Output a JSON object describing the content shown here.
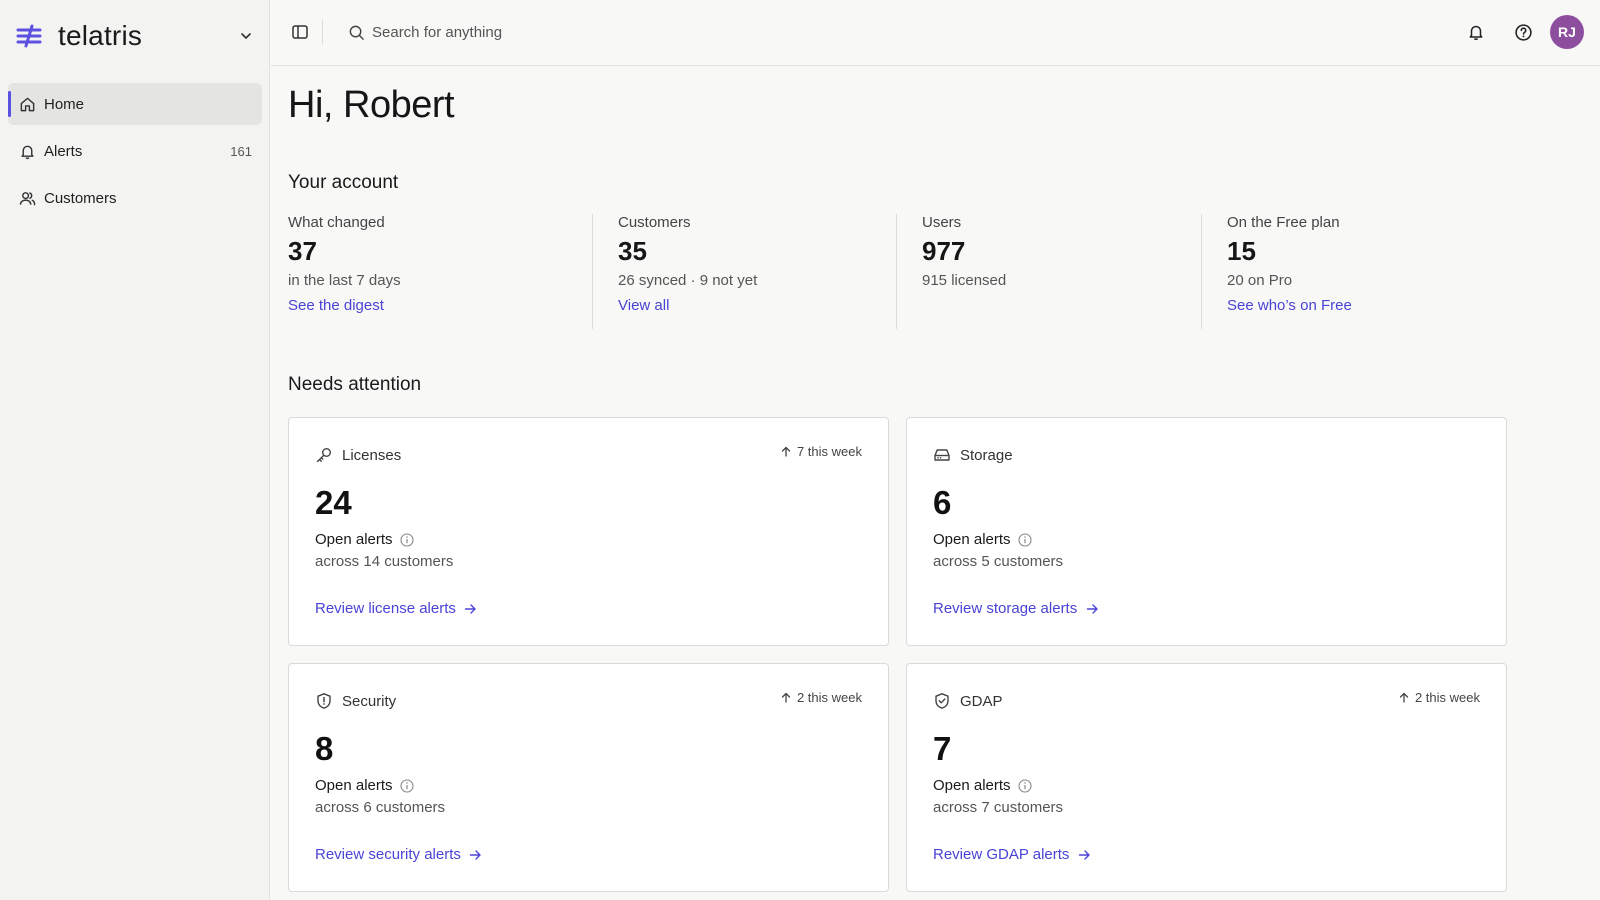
{
  "brand": {
    "name": "telatris",
    "accent": "#5b50e0"
  },
  "sidebar": {
    "items": [
      {
        "label": "Home",
        "icon": "home-icon",
        "count": "",
        "active": true
      },
      {
        "label": "Alerts",
        "icon": "bell-icon",
        "count": "161",
        "active": false
      },
      {
        "label": "Customers",
        "icon": "users-icon",
        "count": "",
        "active": false
      }
    ]
  },
  "topbar": {
    "search_placeholder": "Search for anything",
    "avatar_initials": "RJ",
    "avatar_color": "#8d4e9e"
  },
  "main": {
    "greeting": "Hi, Robert",
    "account_title": "Your account",
    "attention_title": "Needs attention",
    "stats": [
      {
        "label": "What changed",
        "value": "37",
        "sub": "in the last 7 days",
        "link": "See the digest"
      },
      {
        "label": "Customers",
        "value": "35",
        "sub": "26 synced · 9 not yet",
        "link": "View all"
      },
      {
        "label": "Users",
        "value": "977",
        "sub": "915 licensed",
        "link": ""
      },
      {
        "label": "On the Free plan",
        "value": "15",
        "sub": "20 on Pro",
        "link": "See who’s on Free"
      }
    ],
    "cards": [
      {
        "category": "Licenses",
        "icon": "key-icon",
        "trend": "7 this week",
        "count": "24",
        "metric": "Open alerts",
        "sub": "across 14 customers",
        "link": "Review license alerts"
      },
      {
        "category": "Storage",
        "icon": "storage-icon",
        "trend": "",
        "count": "6",
        "metric": "Open alerts",
        "sub": "across 5 customers",
        "link": "Review storage alerts"
      },
      {
        "category": "Security",
        "icon": "shield-alert-icon",
        "trend": "2 this week",
        "count": "8",
        "metric": "Open alerts",
        "sub": "across 6 customers",
        "link": "Review security alerts"
      },
      {
        "category": "GDAP",
        "icon": "shield-check-icon",
        "trend": "2 this week",
        "count": "7",
        "metric": "Open alerts",
        "sub": "across 7 customers",
        "link": "Review GDAP alerts"
      }
    ]
  },
  "colors": {
    "link": "#4a43d6",
    "background": "#f8f8f7",
    "sidebar": "#f3f3f2"
  }
}
